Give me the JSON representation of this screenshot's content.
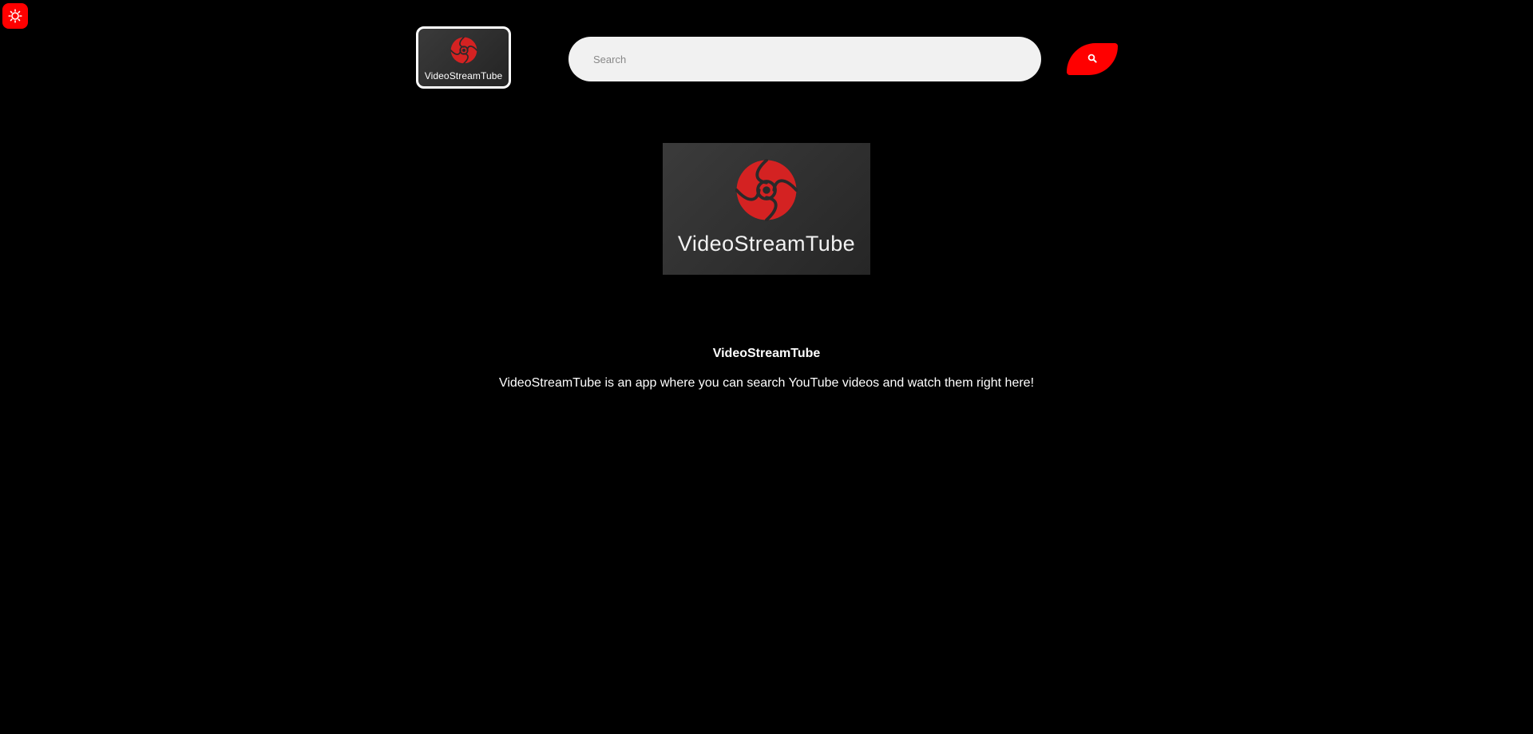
{
  "theme_toggle": {
    "icon": "sun-icon",
    "color": "#ff0000"
  },
  "header": {
    "logo": {
      "icon": "film-reel-icon",
      "label": "VideoStreamTube"
    },
    "search": {
      "placeholder": "Search",
      "value": ""
    },
    "search_button": {
      "icon": "search-icon",
      "color": "#ff0000"
    }
  },
  "main": {
    "hero_logo": {
      "icon": "film-reel-icon",
      "label": "VideoStreamTube"
    },
    "title": "VideoStreamTube",
    "description": "VideoStreamTube is an app where you can search YouTube videos and watch them right here!"
  },
  "colors": {
    "background": "#000000",
    "accent": "#ff0000",
    "brand_mark": "#d42222",
    "text": "#ffffff"
  }
}
